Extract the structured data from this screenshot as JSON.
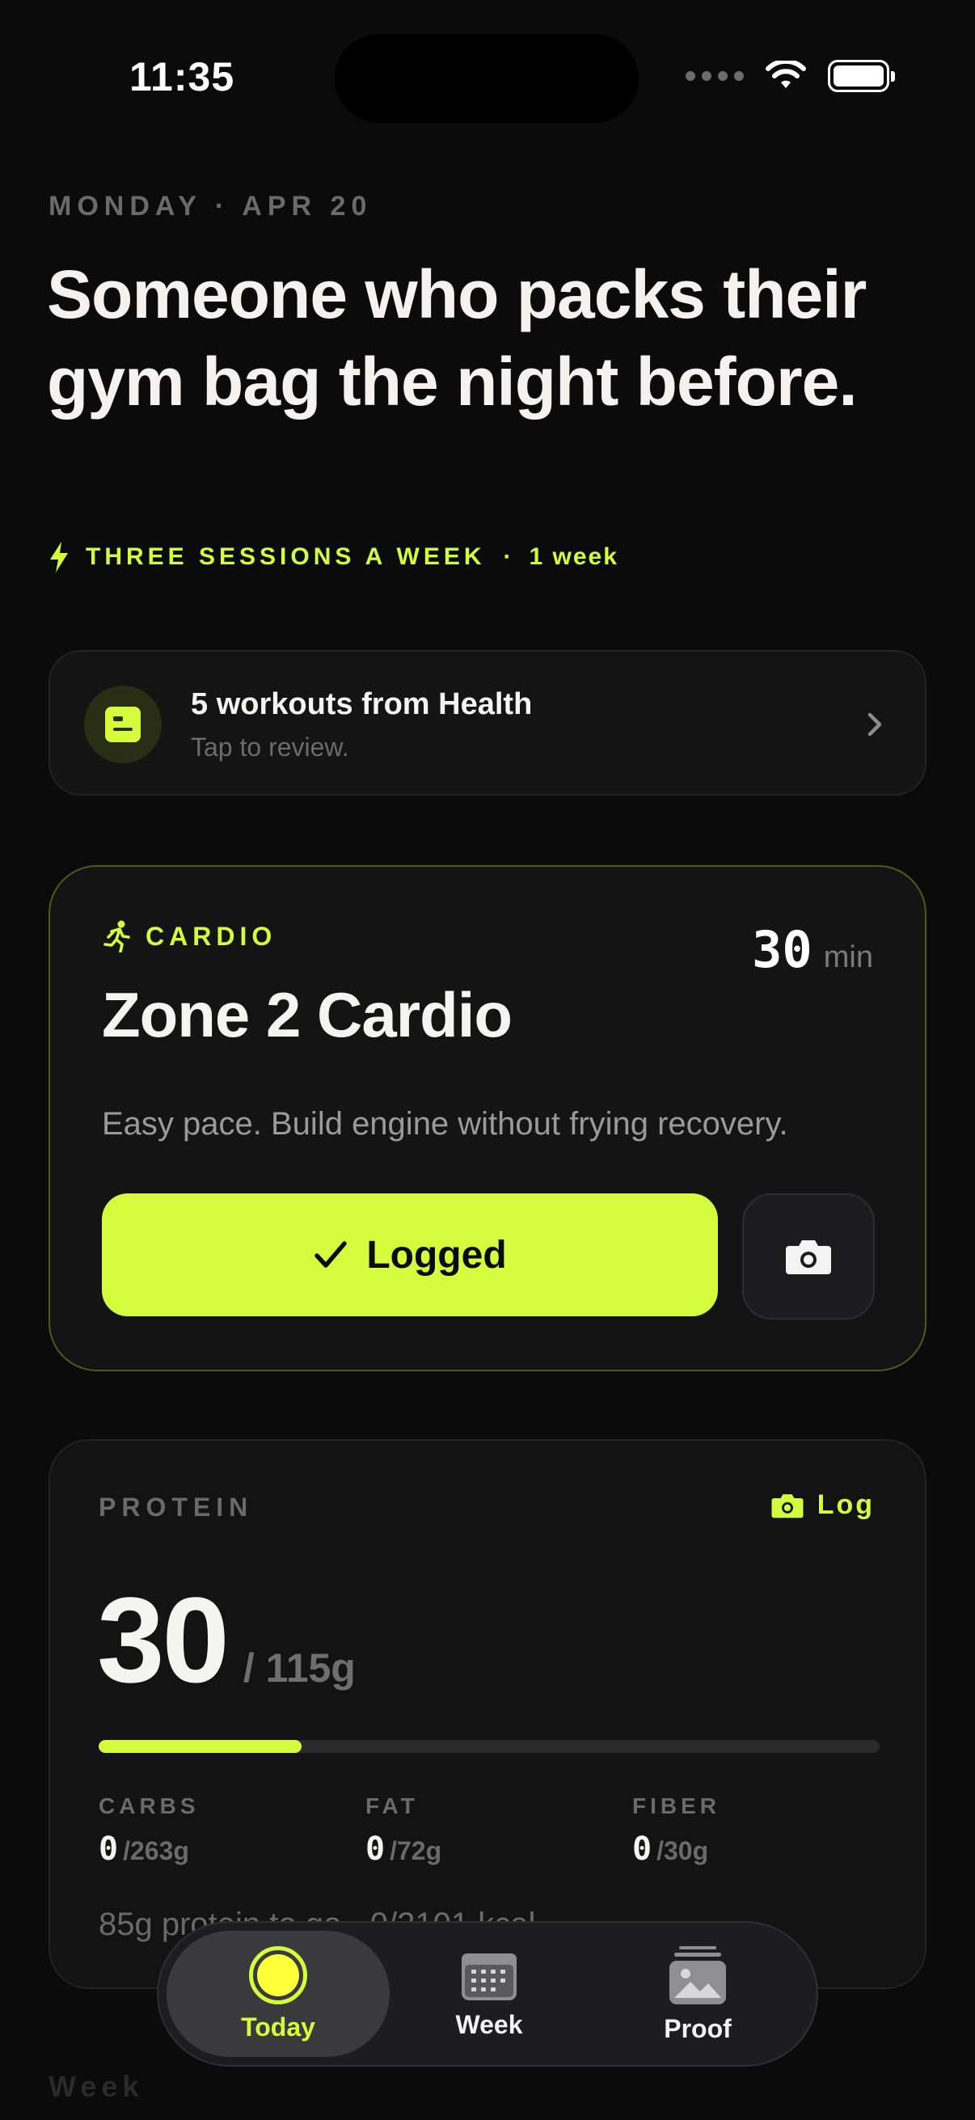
{
  "status_bar": {
    "time": "11:35"
  },
  "header": {
    "date": "MONDAY · APR 20",
    "headline": "Someone who packs their gym bag the night before.",
    "goal_title": "THREE SESSIONS A WEEK",
    "goal_separator": "·",
    "goal_duration": "1 week"
  },
  "health_card": {
    "title": "5 workouts from Health",
    "subtitle": "Tap to review."
  },
  "workout_card": {
    "category": "CARDIO",
    "duration_value": "30",
    "duration_unit": "min",
    "title": "Zone 2 Cardio",
    "description": "Easy pace. Build engine without frying recovery.",
    "logged_label": "Logged"
  },
  "protein_card": {
    "label": "PROTEIN",
    "log_label": "Log",
    "current": "30",
    "goal": "/ 115g",
    "progress_fraction": 0.26,
    "macros": [
      {
        "name": "CARBS",
        "value": "0",
        "goal": "/263g"
      },
      {
        "name": "FAT",
        "value": "0",
        "goal": "/72g"
      },
      {
        "name": "FIBER",
        "value": "0",
        "goal": "/30g"
      }
    ],
    "summary": "85g protein to go · 0/2101 kcal"
  },
  "next_section_label": "Week",
  "tab_bar": {
    "tabs": [
      {
        "label": "Today",
        "icon": "today-ring-icon",
        "active": true
      },
      {
        "label": "Week",
        "icon": "calendar-icon",
        "active": false
      },
      {
        "label": "Proof",
        "icon": "photo-stack-icon",
        "active": false
      }
    ]
  },
  "colors": {
    "background": "#0b0b0c",
    "accent": "#d4fb3c",
    "card": "#141415",
    "muted_text": "#6a6a6a"
  }
}
